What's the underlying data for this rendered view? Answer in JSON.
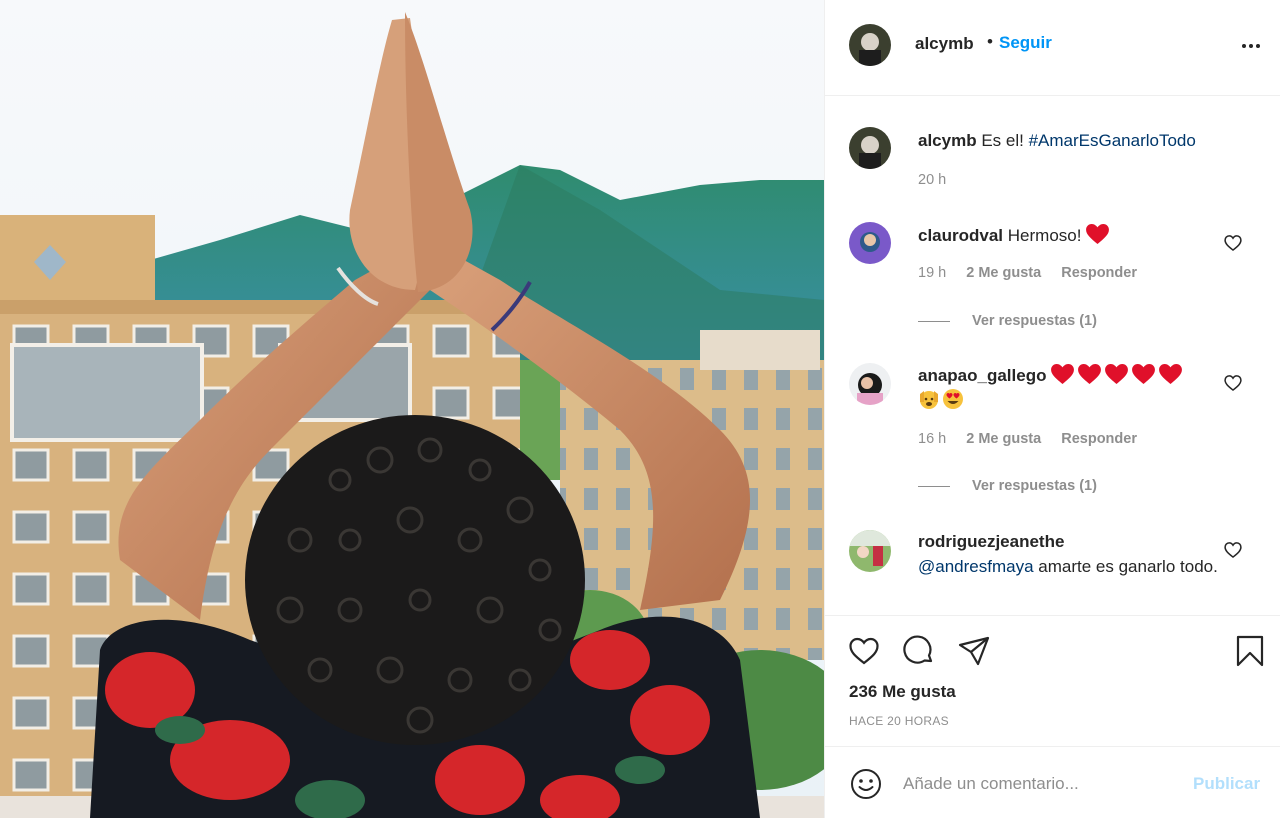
{
  "post": {
    "author": "alcymb",
    "follow_dot": "•",
    "follow_label": "Seguir",
    "more_icon": "more-horizontal-icon"
  },
  "caption": {
    "user": "alcymb",
    "text": "Es el!",
    "hashtag": "#AmarEsGanarloTodo",
    "time": "20 h"
  },
  "comments": [
    {
      "user": "claurodval",
      "text": "Hermoso!",
      "emoji": [
        "red-heart"
      ],
      "time": "19 h",
      "likes": "2 Me gusta",
      "reply": "Responder",
      "view_replies": "Ver respuestas (1)"
    },
    {
      "user": "anapao_gallego",
      "emoji_line1": [
        "red-heart",
        "red-heart",
        "red-heart",
        "red-heart",
        "red-heart"
      ],
      "emoji_line2": [
        "raising-hands-face",
        "heart-eyes-face"
      ],
      "time": "16 h",
      "likes": "2 Me gusta",
      "reply": "Responder",
      "view_replies": "Ver respuestas (1)"
    },
    {
      "user": "rodriguezjeanethe",
      "mention": "@andresfmaya",
      "text": "amarte es ganarlo todo."
    }
  ],
  "actions": {
    "likes": "236 Me gusta",
    "posted": "HACE 20 HORAS",
    "icons": [
      "heart-icon",
      "comment-icon",
      "share-icon",
      "bookmark-icon"
    ]
  },
  "composer": {
    "placeholder": "Añade un comentario...",
    "post_label": "Publicar"
  },
  "colors": {
    "link": "#0095f6",
    "hashtag": "#00376b",
    "muted": "#8e8e8e",
    "heart": "#e0102a",
    "publish_disabled": "#b2dffc"
  }
}
